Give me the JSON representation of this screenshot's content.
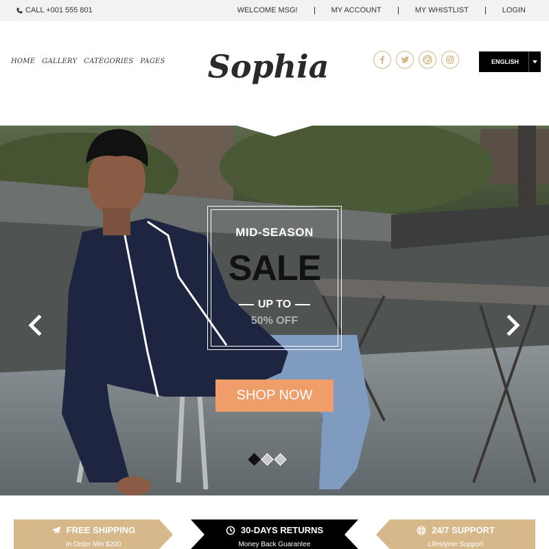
{
  "topbar": {
    "call": "CALL +001 555 801",
    "links": [
      "WELCOME MSG!",
      "MY ACCOUNT",
      "MY WHISTLIST",
      "LOGIN"
    ]
  },
  "nav": {
    "items": [
      "HOME",
      "GALLERY",
      "CATEGORIES",
      "PAGES"
    ]
  },
  "logo": {
    "text": "Sophia"
  },
  "social": {
    "icons": [
      "facebook-icon",
      "twitter-icon",
      "pinterest-icon",
      "instagram-icon"
    ]
  },
  "language": {
    "selected": "ENGLISH"
  },
  "hero": {
    "line1": "MID-SEASON",
    "line2": "SALE",
    "line3": "UP TO",
    "line4": "50% OFF",
    "cta": "SHOP NOW",
    "slides": 3,
    "active_slide": 1
  },
  "features": [
    {
      "title": "FREE SHIPPING",
      "subtitle": "In Order Min $200",
      "icon": "plane-icon"
    },
    {
      "title": "30-DAYS RETURNS",
      "subtitle": "Money Back Guarantee",
      "icon": "clock-icon"
    },
    {
      "title": "24/7 SUPPORT",
      "subtitle": "Lifestyme Support",
      "icon": "lifebuoy-icon"
    }
  ],
  "colors": {
    "gold": "#d6b88a",
    "orange": "#ef9e69",
    "black": "#000000",
    "topbar": "#f2f2f2"
  }
}
